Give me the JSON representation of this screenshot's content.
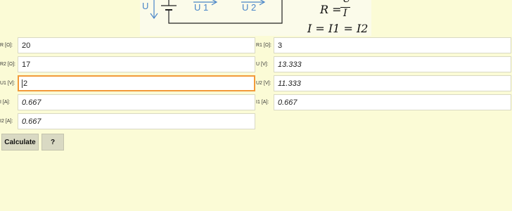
{
  "diagram": {
    "u_label": "U",
    "u1_label": "U 1",
    "u2_label": "U 2",
    "formula_r": "R =",
    "formula_num": "U",
    "formula_den": "I",
    "formula_i": "I = I1 = I2"
  },
  "fields": {
    "r": {
      "label": "R [Ω]:",
      "value": "20"
    },
    "r1": {
      "label": "R1 [Ω]:",
      "value": "3"
    },
    "r2": {
      "label": "R2 [Ω]:",
      "value": "17"
    },
    "u": {
      "label": "U [V]:",
      "value": "13.333"
    },
    "u1": {
      "label": "U1 [V]:",
      "value": "2"
    },
    "u2": {
      "label": "U2 [V]:",
      "value": "11.333"
    },
    "i": {
      "label": "I [A]:",
      "value": "0.667"
    },
    "i1": {
      "label": "I1 [A]:",
      "value": "0.667"
    },
    "i2": {
      "label": "I2 [A]:",
      "value": "0.667"
    }
  },
  "buttons": {
    "calculate": "Calculate",
    "help": "?"
  },
  "colors": {
    "arrow": "#4a86c8",
    "focus": "#f29a3a"
  }
}
